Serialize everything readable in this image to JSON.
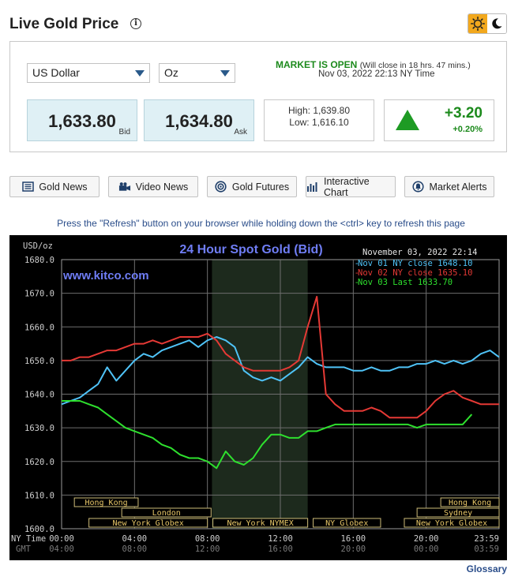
{
  "header": {
    "title": "Live Gold Price",
    "info_icon": "info-icon",
    "theme_icons": [
      "sun-icon",
      "moon-icon"
    ]
  },
  "selectors": {
    "currency": "US Dollar",
    "unit": "Oz"
  },
  "market": {
    "status": "MARKET IS OPEN",
    "note": "(Will close in 18 hrs. 47 mins.)",
    "time": "Nov 03, 2022 22:13 NY Time"
  },
  "prices": {
    "bid": "1,633.80",
    "bid_label": "Bid",
    "ask": "1,634.80",
    "ask_label": "Ask"
  },
  "range": {
    "high": "High: 1,639.80",
    "low": "Low: 1,616.10"
  },
  "change": {
    "amount": "+3.20",
    "percent": "+0.20%",
    "direction": "up",
    "color": "#1e9b24"
  },
  "nav": [
    {
      "label": "Gold News",
      "icon": "newspaper-icon"
    },
    {
      "label": "Video News",
      "icon": "video-camera-icon"
    },
    {
      "label": "Gold Futures",
      "icon": "target-icon"
    },
    {
      "label": "Interactive Chart",
      "icon": "bar-chart-icon"
    },
    {
      "label": "Market Alerts",
      "icon": "bell-icon"
    }
  ],
  "refresh_note": "Press the \"Refresh\" button on your browser while holding down the <ctrl> key to refresh this page",
  "glossary": "Glossary",
  "chart_data": {
    "type": "line",
    "title": "24 Hour Spot Gold (Bid)",
    "watermark": "www.kitco.com",
    "date": "November 03, 2022 22:14",
    "ylabel": "USD/oz",
    "ylim": [
      1600,
      1680
    ],
    "yticks": [
      "1680.0",
      "1670.0",
      "1660.0",
      "1650.0",
      "1640.0",
      "1630.0",
      "1620.0",
      "1610.0",
      "1600.0"
    ],
    "x_label_ny": "NY Time",
    "x_label_gmt": "GMT",
    "xticks_ny": [
      "00:00",
      "04:00",
      "08:00",
      "12:00",
      "16:00",
      "20:00",
      "23:59"
    ],
    "xticks_gmt": [
      "04:00",
      "08:00",
      "12:00",
      "16:00",
      "20:00",
      "00:00",
      "03:59"
    ],
    "grid": true,
    "legend_position": "top-right",
    "sessions": [
      "Hong Kong",
      "London",
      "New York Globex",
      "New York NYMEX",
      "NY Globex",
      "Hong Kong",
      "Sydney",
      "New York Globex"
    ],
    "series": [
      {
        "name": "Nov 01 NY close 1648.10",
        "color": "#4fc3f7",
        "x": [
          0,
          0.5,
          1,
          1.5,
          2,
          2.5,
          3,
          3.5,
          4,
          4.5,
          5,
          5.5,
          6,
          6.5,
          7,
          7.5,
          8,
          8.5,
          9,
          9.5,
          10,
          10.5,
          11,
          11.5,
          12,
          12.5,
          13,
          13.5,
          14,
          14.5,
          15,
          15.5,
          16,
          16.5,
          17,
          17.5,
          18,
          18.5,
          19,
          19.5,
          20,
          20.5,
          21,
          21.5,
          22,
          22.5,
          23,
          23.5,
          24
        ],
        "values": [
          1637,
          1638,
          1639,
          1641,
          1643,
          1648,
          1644,
          1647,
          1650,
          1652,
          1651,
          1653,
          1654,
          1655,
          1656,
          1654,
          1656,
          1657,
          1656,
          1654,
          1647,
          1645,
          1644,
          1645,
          1644,
          1646,
          1648,
          1651,
          1649,
          1648,
          1648,
          1648,
          1647,
          1647,
          1648,
          1647,
          1647,
          1648,
          1648,
          1649,
          1649,
          1650,
          1649,
          1650,
          1649,
          1650,
          1652,
          1653,
          1651
        ]
      },
      {
        "name": "Nov 02 NY close 1635.10",
        "color": "#e53935",
        "x": [
          0,
          0.5,
          1,
          1.5,
          2,
          2.5,
          3,
          3.5,
          4,
          4.5,
          5,
          5.5,
          6,
          6.5,
          7,
          7.5,
          8,
          8.5,
          9,
          9.5,
          10,
          10.5,
          11,
          11.5,
          12,
          12.5,
          13,
          13.5,
          14,
          14.5,
          15,
          15.5,
          16,
          16.5,
          17,
          17.5,
          18,
          18.5,
          19,
          19.5,
          20,
          20.5,
          21,
          21.5,
          22,
          22.5,
          23,
          23.5,
          24
        ],
        "values": [
          1650,
          1650,
          1651,
          1651,
          1652,
          1653,
          1653,
          1654,
          1655,
          1655,
          1656,
          1655,
          1656,
          1657,
          1657,
          1657,
          1658,
          1656,
          1652,
          1650,
          1648,
          1647,
          1647,
          1647,
          1647,
          1648,
          1650,
          1660,
          1669,
          1640,
          1637,
          1635,
          1635,
          1635,
          1636,
          1635,
          1633,
          1633,
          1633,
          1633,
          1635,
          1638,
          1640,
          1641,
          1639,
          1638,
          1637,
          1637,
          1637
        ]
      },
      {
        "name": "Nov 03 Last 1633.70",
        "color": "#2ee02e",
        "x": [
          0,
          0.5,
          1,
          1.5,
          2,
          2.5,
          3,
          3.5,
          4,
          4.5,
          5,
          5.5,
          6,
          6.5,
          7,
          7.5,
          8,
          8.5,
          9,
          9.5,
          10,
          10.5,
          11,
          11.5,
          12,
          12.5,
          13,
          13.5,
          14,
          14.5,
          15,
          15.5,
          16,
          16.5,
          17,
          17.5,
          18,
          18.5,
          19,
          19.5,
          20,
          20.5,
          21,
          21.5,
          22,
          22.5
        ],
        "values": [
          1638,
          1638,
          1638,
          1637,
          1636,
          1634,
          1632,
          1630,
          1629,
          1628,
          1627,
          1625,
          1624,
          1622,
          1621,
          1621,
          1620,
          1618,
          1623,
          1620,
          1619,
          1621,
          1625,
          1628,
          1628,
          1627,
          1627,
          1629,
          1629,
          1630,
          1631,
          1631,
          1631,
          1631,
          1631,
          1631,
          1631,
          1631,
          1631,
          1630,
          1631,
          1631,
          1631,
          1631,
          1631,
          1634
        ]
      }
    ]
  }
}
